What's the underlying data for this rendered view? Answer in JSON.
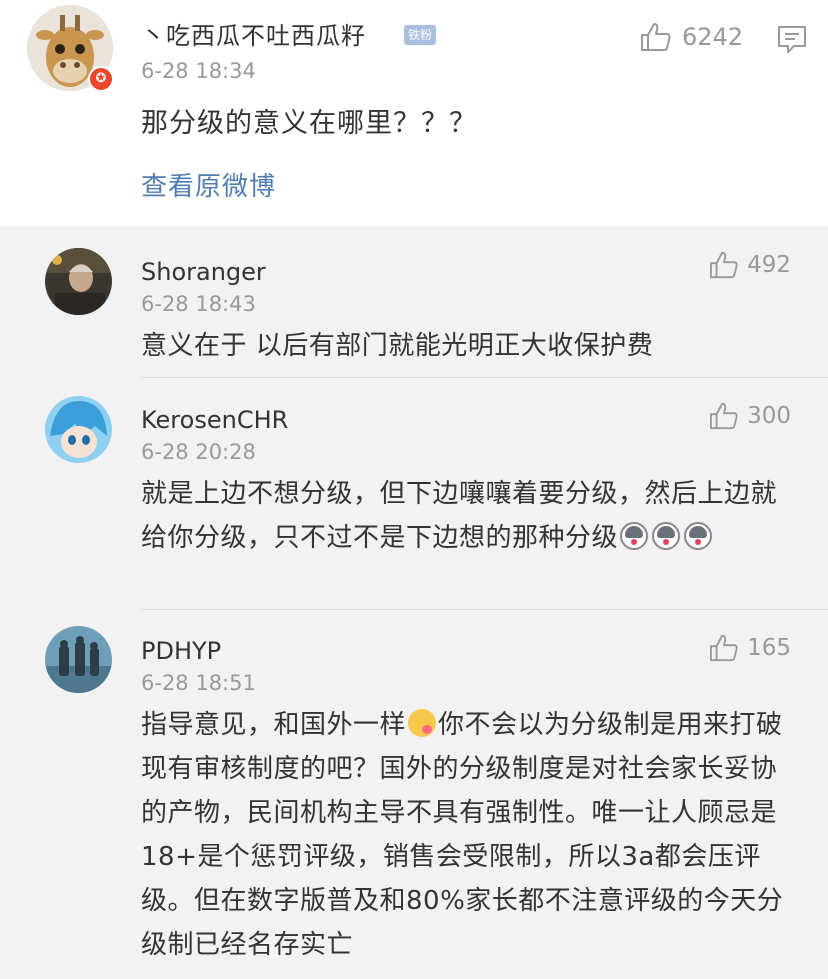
{
  "main_comment": {
    "username": "丶吃西瓜不吐西瓜籽",
    "fan_badge": "铁粉",
    "time": "6-28 18:34",
    "text": "那分级的意义在哪里？？？",
    "likes": "6242",
    "view_original": "查看原微博",
    "vip_badge_icon": "✪"
  },
  "replies": [
    {
      "username": "Shoranger",
      "time": "6-28 18:43",
      "text": "意义在于 以后有部门就能光明正大收保护费",
      "likes": "492"
    },
    {
      "username": "KerosenCHR",
      "time": "6-28 20:28",
      "text": "就是上边不想分级，但下边嚷嚷着要分级，然后上边就给你分级，只不过不是下边想的那种分级",
      "likes": "300"
    },
    {
      "username": "PDHYP",
      "time": "6-28 18:51",
      "text_before_emoji": "指导意见，和国外一样",
      "text_after_emoji": "你不会以为分级制是用来打破现有审核制度的吧？国外的分级制度是对社会家长妥协的产物，民间机构主导不具有强制性。唯一让人顾忌是18+是个惩罚评级，销售会受限制，所以3a都会压评级。但在数字版普及和80%家长都不注意评级的今天分级制已经名存实亡",
      "likes": "165"
    }
  ],
  "colors": {
    "link": "#507daf",
    "secondary_text": "#999999",
    "primary_text": "#333333",
    "background": "#f2f2f2",
    "fan_badge": "#a9bfe0",
    "vip_badge": "#e8472a"
  },
  "icons": {
    "like": "thumbs-up-icon",
    "reply": "comment-bubble-icon",
    "emoji_1": "husky-emoji",
    "emoji_2": "yum-emoji"
  }
}
